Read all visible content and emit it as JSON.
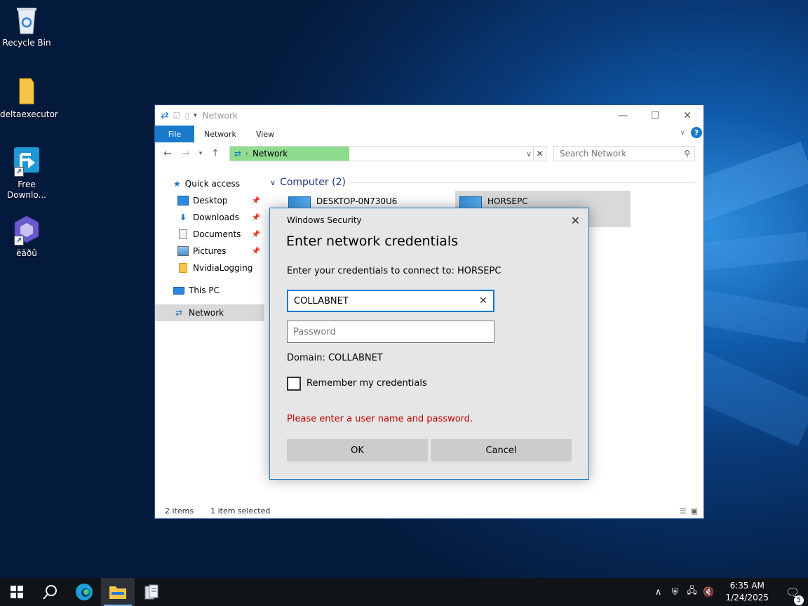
{
  "desktop": {
    "icons": [
      {
        "label": "Recycle Bin",
        "icon": "recycle-bin-icon"
      },
      {
        "label": "deltaexecutor",
        "icon": "folder-icon"
      },
      {
        "label": "Free Downlo...",
        "icon": "free-download-manager-icon"
      },
      {
        "label": "ëãðû",
        "icon": "gamecube-icon"
      }
    ]
  },
  "explorer": {
    "title": "Network",
    "ribbon_tabs": [
      "File",
      "Network",
      "View"
    ],
    "address": {
      "crumb": "Network"
    },
    "search": {
      "placeholder": "Search Network"
    },
    "sidebar": {
      "items": [
        {
          "label": "Quick access",
          "icon": "star-icon"
        },
        {
          "label": "Desktop",
          "icon": "desktop-icon",
          "pinned": true
        },
        {
          "label": "Downloads",
          "icon": "download-icon",
          "pinned": true
        },
        {
          "label": "Documents",
          "icon": "document-icon",
          "pinned": true
        },
        {
          "label": "Pictures",
          "icon": "pictures-icon",
          "pinned": true
        },
        {
          "label": "NvidiaLogging",
          "icon": "folder-icon"
        },
        {
          "label": "This PC",
          "icon": "computer-icon"
        },
        {
          "label": "Network",
          "icon": "network-icon",
          "selected": true
        }
      ]
    },
    "group": {
      "label": "Computer (2)"
    },
    "computers": [
      {
        "name": "DESKTOP-0N730U6"
      },
      {
        "name": "HORSEPC",
        "selected": true
      }
    ],
    "status": {
      "items": "2 items",
      "selected": "1 item selected"
    }
  },
  "dialog": {
    "caption": "Windows Security",
    "title": "Enter network credentials",
    "prompt": "Enter your credentials to connect to: HORSEPC",
    "username_value": "COLLABNET",
    "password_placeholder": "Password",
    "domain": "Domain: COLLABNET",
    "remember_label": "Remember my credentials",
    "error": "Please enter a user name and password.",
    "ok_label": "OK",
    "cancel_label": "Cancel",
    "accent_color": "#1979ca",
    "error_color": "#c00000"
  },
  "taskbar": {
    "time": "6:35 AM",
    "date": "1/24/2025",
    "notification_count": "5"
  }
}
